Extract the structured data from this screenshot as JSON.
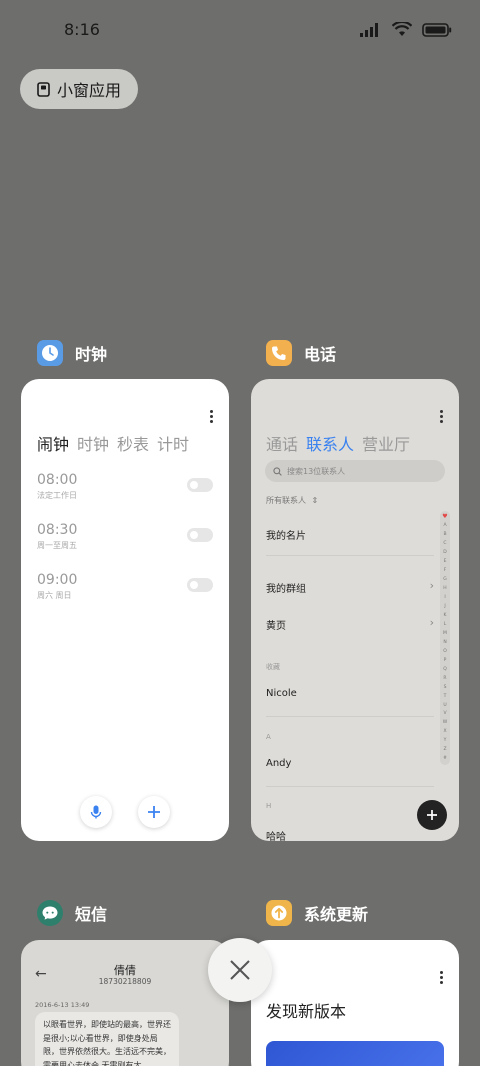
{
  "status_bar": {
    "time": "8:16"
  },
  "floating_window": {
    "label": "小窗应用"
  },
  "apps": {
    "clock": {
      "name": "时钟",
      "tabs": [
        "闹钟",
        "时钟",
        "秒表",
        "计时"
      ],
      "alarms": [
        {
          "time": "08:00",
          "repeat": "法定工作日"
        },
        {
          "time": "08:30",
          "repeat": "周一至周五"
        },
        {
          "time": "09:00",
          "repeat": "周六 周日"
        }
      ]
    },
    "phone": {
      "name": "电话",
      "tabs": [
        "通话",
        "联系人",
        "营业厅"
      ],
      "search_placeholder": "搜索13位联系人",
      "all_contacts": "所有联系人",
      "my_card": "我的名片",
      "my_groups": "我的群组",
      "yellow_pages": "黄页",
      "favorites_label": "收藏",
      "section_a": "A",
      "section_h": "H",
      "contacts": [
        "Nicole",
        "Andy",
        "哈哈"
      ],
      "alphabet": [
        "A",
        "B",
        "C",
        "D",
        "E",
        "F",
        "G",
        "H",
        "I",
        "J",
        "K",
        "L",
        "M",
        "N",
        "O",
        "P",
        "Q",
        "R",
        "S",
        "T",
        "U",
        "V",
        "W",
        "X",
        "Y",
        "Z",
        "#"
      ]
    },
    "sms": {
      "name": "短信",
      "contact_name": "倩倩",
      "contact_number": "18730218809",
      "date": "2016-6-13 13:49",
      "message": "以眼看世界，即使站的最高，世界还是很小;以心看世界，即使身处局限，世界依然很大。生活远不完美，需要用心去体会,无需刚有太"
    },
    "update": {
      "name": "系统更新",
      "title": "发现新版本"
    }
  },
  "colors": {
    "background": "#6e6e6c",
    "accent": "#3a82f0",
    "clock_icon": "#5a9be6",
    "phone_icon": "#f2b04f",
    "sms_icon": "#2f7f6d",
    "update_icon": "#f0b54a"
  }
}
